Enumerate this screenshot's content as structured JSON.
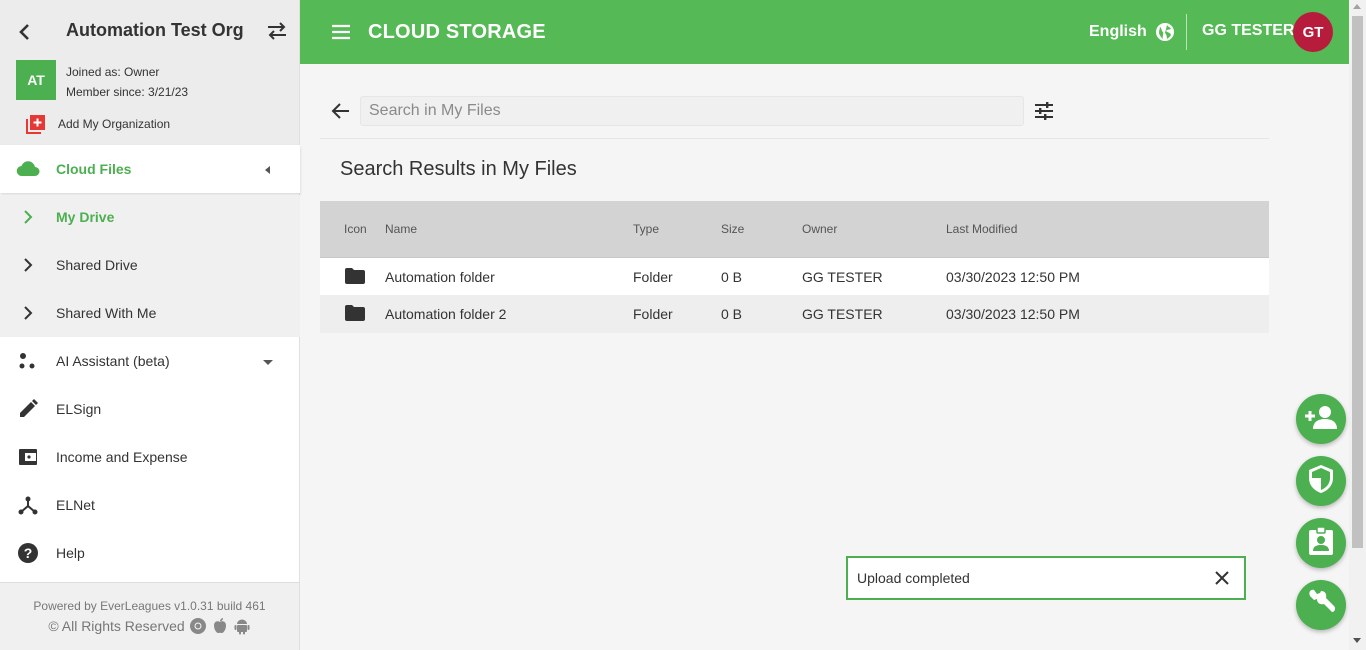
{
  "org": {
    "name": "Automation Test Org",
    "avatar_initials": "AT",
    "joined_as": "Joined as: Owner",
    "member_since": "Member since: 3/21/23",
    "add_org_label": "Add My Organization"
  },
  "nav": {
    "cloud_files": "Cloud Files",
    "my_drive": "My Drive",
    "shared_drive": "Shared Drive",
    "shared_with_me": "Shared With Me",
    "ai_assistant": "AI Assistant (beta)",
    "elsign": "ELSign",
    "income_expense": "Income and Expense",
    "elnet": "ELNet",
    "help": "Help"
  },
  "footer": {
    "powered_by": "Powered by EverLeagues v1.0.31 build 461",
    "rights": "© All Rights Reserved"
  },
  "header": {
    "title": "CLOUD STORAGE",
    "language": "English",
    "user_name": "GG TESTER",
    "user_initials": "GT"
  },
  "search": {
    "placeholder": "Search in My Files",
    "value": ""
  },
  "results": {
    "title": "Search Results in My Files",
    "columns": {
      "icon": "Icon",
      "name": "Name",
      "type": "Type",
      "size": "Size",
      "owner": "Owner",
      "modified": "Last Modified"
    },
    "rows": [
      {
        "icon": "folder-icon",
        "name": "Automation folder",
        "type": "Folder",
        "size": "0 B",
        "owner": "GG TESTER",
        "modified": "03/30/2023 12:50 PM"
      },
      {
        "icon": "folder-icon",
        "name": "Automation folder 2",
        "type": "Folder",
        "size": "0 B",
        "owner": "GG TESTER",
        "modified": "03/30/2023 12:50 PM"
      }
    ]
  },
  "toast": {
    "message": "Upload completed"
  },
  "colors": {
    "brand_green": "#55b955",
    "accent_green": "#4caf50",
    "avatar_red": "#b71c3c",
    "add_org_red": "#e53935"
  },
  "fabs": [
    "add-person-icon",
    "shield-icon",
    "contact-card-icon",
    "wrench-icon"
  ]
}
